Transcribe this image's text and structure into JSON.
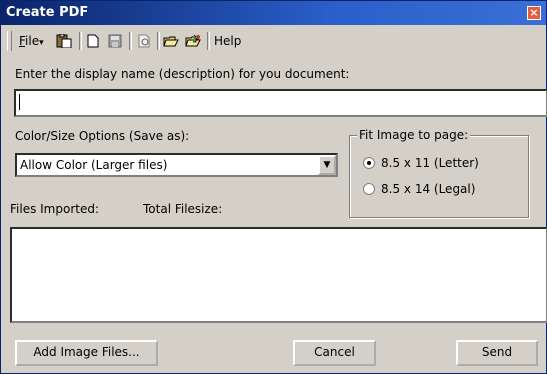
{
  "window": {
    "title": "Create PDF",
    "close_glyph": "×"
  },
  "toolbar": {
    "file_label_u": "F",
    "file_label_rest": "ile",
    "file_arrow": "▾",
    "help_label": "Help",
    "icons": [
      "paste-icon",
      "new-document-icon",
      "save-icon",
      "preview-icon",
      "open-folder-icon",
      "import-folder-icon"
    ]
  },
  "form": {
    "display_name_label": "Enter the display name (description) for you document:",
    "display_name_value": "",
    "color_size_label": "Color/Size Options (Save as):",
    "color_size_selected": "Allow Color (Larger files)",
    "fit_image": {
      "title": "Fit Image to page:",
      "options": [
        {
          "label": "8.5 x 11 (Letter)",
          "checked": true
        },
        {
          "label": "8.5 x 14 (Legal)",
          "checked": false
        }
      ]
    },
    "files_imported_label": "Files Imported:",
    "total_filesize_label": "Total Filesize:"
  },
  "buttons": {
    "add_image_files": "Add Image Files...",
    "cancel": "Cancel",
    "send": "Send"
  },
  "colors": {
    "face": "#d4d0c8",
    "title_start": "#0a246a",
    "title_end": "#3a6fd8"
  }
}
